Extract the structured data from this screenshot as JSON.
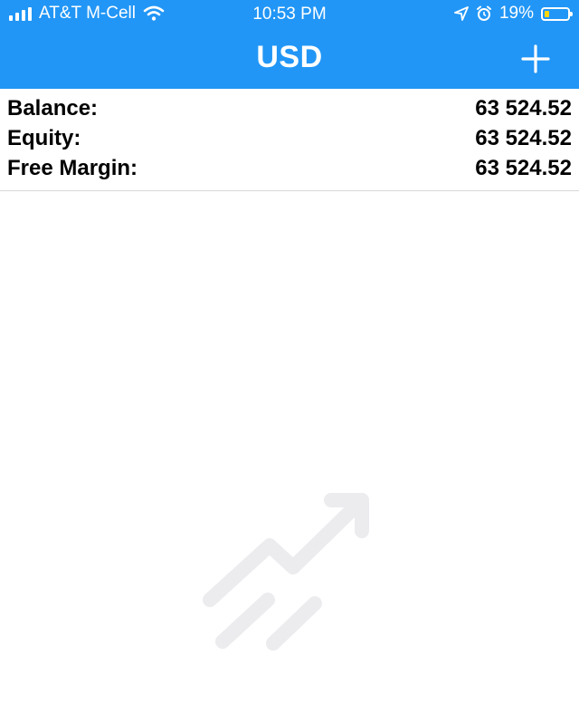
{
  "status_bar": {
    "carrier": "AT&T M-Cell",
    "time": "10:53 PM",
    "battery_percent": "19%",
    "battery_level": 0.19
  },
  "header": {
    "title": "USD",
    "add_icon": "plus-icon",
    "background_color": "#2196f6"
  },
  "account": {
    "rows": [
      {
        "label": "Balance:",
        "value": "63 524.52"
      },
      {
        "label": "Equity:",
        "value": "63 524.52"
      },
      {
        "label": "Free Margin:",
        "value": "63 524.52"
      }
    ]
  },
  "empty_state": {
    "icon": "trade-chart-icon"
  }
}
